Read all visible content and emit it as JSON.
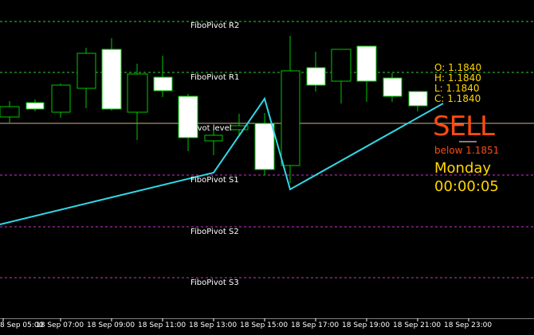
{
  "levels": {
    "r2": "FiboPivot R2",
    "r1": "FiboPivot R1",
    "pivot": "Pivot level",
    "s1": "FiboPivot S1",
    "s2": "FiboPivot S2",
    "s3": "FiboPivot S3"
  },
  "ohlc": {
    "open": "O: 1.1840",
    "high": "H: 1.1840",
    "low": "L: 1.1840",
    "close": "C: 1.1840"
  },
  "signal": {
    "text": "SELL",
    "below": "below 1.1851"
  },
  "timer": {
    "day": "Monday",
    "countdown": "00:00:05"
  },
  "xaxis": {
    "labels": [
      "8 Sep 05:00",
      "18 Sep 07:00",
      "18 Sep 09:00",
      "18 Sep 11:00",
      "18 Sep 13:00",
      "18 Sep 15:00",
      "18 Sep 17:00",
      "18 Sep 19:00",
      "18 Sep 21:00",
      "18 Sep 23:00"
    ]
  },
  "colors": {
    "background": "#000000",
    "bull_body": "#ffffff",
    "candle_outline": "#00c800",
    "zigzag": "#33d6e6",
    "resistance_line": "#33cc33",
    "support_line": "#cc33cc",
    "pivot_line": "#d2b48c",
    "text_yellow": "#ffd700",
    "signal_red": "#ff4a10"
  }
}
